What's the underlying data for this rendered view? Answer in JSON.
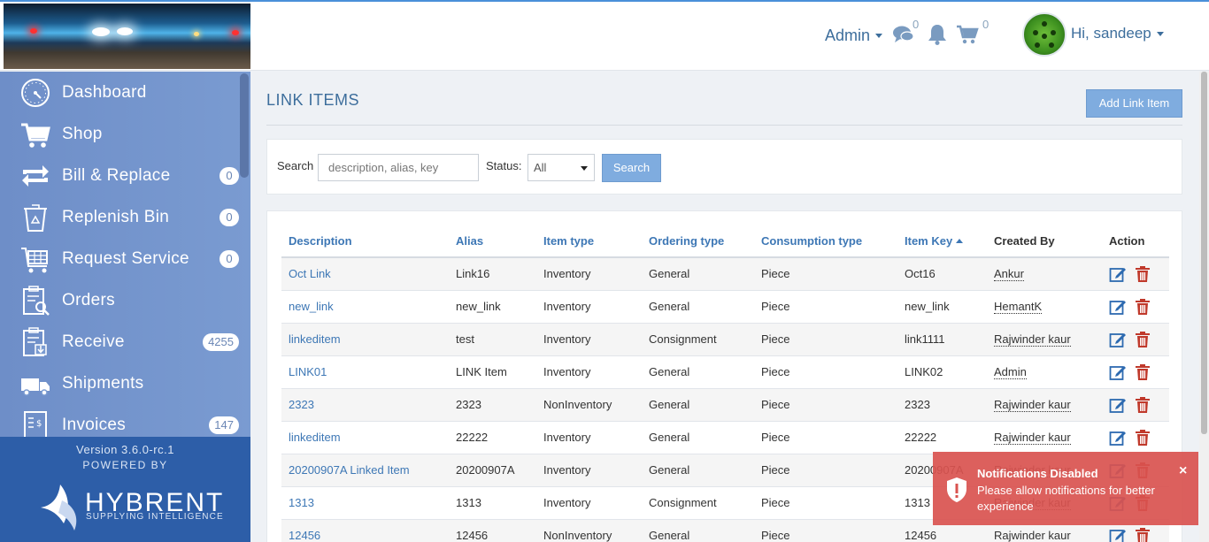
{
  "header": {
    "admin_label": "Admin",
    "messages_count": "0",
    "cart_count": "0",
    "greeting": "Hi, sandeep"
  },
  "sidebar": {
    "items": [
      {
        "label": "Dashboard",
        "badge": "",
        "icon": "dashboard-gauge-icon"
      },
      {
        "label": "Shop",
        "badge": "",
        "icon": "shopping-cart-icon"
      },
      {
        "label": "Bill & Replace",
        "badge": "0",
        "icon": "exchange-icon"
      },
      {
        "label": "Replenish Bin",
        "badge": "0",
        "icon": "recycle-bin-icon"
      },
      {
        "label": "Request Service",
        "badge": "0",
        "icon": "service-cart-icon"
      },
      {
        "label": "Orders",
        "badge": "",
        "icon": "orders-clipboard-icon"
      },
      {
        "label": "Receive",
        "badge": "4255",
        "icon": "receive-clipboard-icon"
      },
      {
        "label": "Shipments",
        "badge": "",
        "icon": "truck-icon"
      },
      {
        "label": "Invoices",
        "badge": "147",
        "icon": "invoice-icon"
      }
    ],
    "version": "Version 3.6.0-rc.1",
    "powered_by": "POWERED BY",
    "brand_name": "HYBRENT",
    "brand_tagline": "SUPPLYING INTELLIGENCE"
  },
  "main": {
    "title": "LINK ITEMS",
    "add_button": "Add Link Item",
    "search_label": "Search",
    "search_placeholder": "description, alias, key",
    "status_label": "Status:",
    "status_value": "All",
    "search_button": "Search"
  },
  "table": {
    "columns": [
      "Description",
      "Alias",
      "Item type",
      "Ordering type",
      "Consumption type",
      "Item Key",
      "Created By",
      "Action"
    ],
    "rows": [
      [
        "Oct Link",
        "Link16",
        "Inventory",
        "General",
        "Piece",
        "Oct16",
        "Ankur"
      ],
      [
        "new_link",
        "new_link",
        "Inventory",
        "General",
        "Piece",
        "new_link",
        "HemantK"
      ],
      [
        "linkeditem",
        "test",
        "Inventory",
        "Consignment",
        "Piece",
        "link1111",
        "Rajwinder kaur"
      ],
      [
        "LINK01",
        "LINK Item",
        "Inventory",
        "General",
        "Piece",
        "LINK02",
        "Admin"
      ],
      [
        "2323",
        "2323",
        "NonInventory",
        "General",
        "Piece",
        "2323",
        "Rajwinder kaur"
      ],
      [
        "linkeditem",
        "22222",
        "Inventory",
        "General",
        "Piece",
        "22222",
        "Rajwinder kaur"
      ],
      [
        "20200907A Linked Item",
        "20200907A",
        "Inventory",
        "General",
        "Piece",
        "20200907A",
        "Rajwinder kaur"
      ],
      [
        "1313",
        "1313",
        "Inventory",
        "Consignment",
        "Piece",
        "1313",
        "Rajwinder kaur"
      ],
      [
        "12456",
        "12456",
        "NonInventory",
        "General",
        "Piece",
        "12456",
        "Rajwinder kaur"
      ]
    ]
  },
  "toast": {
    "title": "Notifications Disabled",
    "message": "Please allow notifications for better experience",
    "close": "×"
  },
  "colors": {
    "accent": "#3d77b5",
    "sidebar": "#7a9bd1",
    "sidebar_footer": "#2d5ea8",
    "button": "#7facdf",
    "toast": "#d9534f",
    "delete": "#c0392b"
  }
}
